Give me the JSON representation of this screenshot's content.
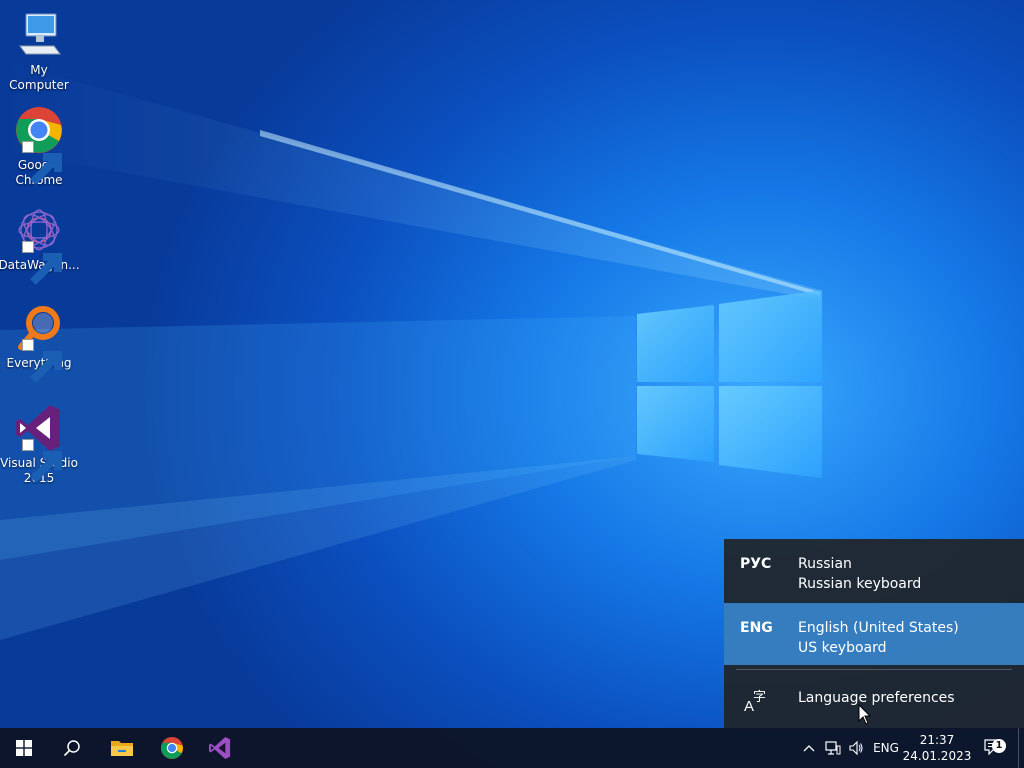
{
  "desktop": {
    "icons": [
      {
        "label": "My Computer",
        "icon": "computer-icon"
      },
      {
        "label": "Google Chrome",
        "icon": "chrome-icon"
      },
      {
        "label": "DataWagon...",
        "icon": "datawagon-icon"
      },
      {
        "label": "Everything",
        "icon": "everything-search-icon"
      },
      {
        "label": "Visual Studio 2015",
        "icon": "visual-studio-icon"
      }
    ]
  },
  "language_flyout": {
    "items": [
      {
        "code": "РУС",
        "name": "Russian",
        "keyboard": "Russian keyboard",
        "selected": false
      },
      {
        "code": "ENG",
        "name": "English (United States)",
        "keyboard": "US keyboard",
        "selected": true
      }
    ],
    "preferences_label": "Language preferences",
    "preferences_icon": "language-icon"
  },
  "taskbar": {
    "pinned": [
      {
        "name": "start",
        "icon": "windows-logo-icon"
      },
      {
        "name": "search",
        "icon": "search-icon"
      },
      {
        "name": "file-explorer",
        "icon": "folder-icon"
      },
      {
        "name": "chrome",
        "icon": "chrome-icon"
      },
      {
        "name": "visual-studio",
        "icon": "visual-studio-icon"
      }
    ],
    "tray": {
      "input_indicator": "ENG",
      "time": "21:37",
      "date": "24.01.2023",
      "notification_count": "1"
    }
  },
  "colors": {
    "accent": "#3a8cd6",
    "flyout_bg": "#20252b",
    "taskbar_bg": "#0c1426"
  }
}
